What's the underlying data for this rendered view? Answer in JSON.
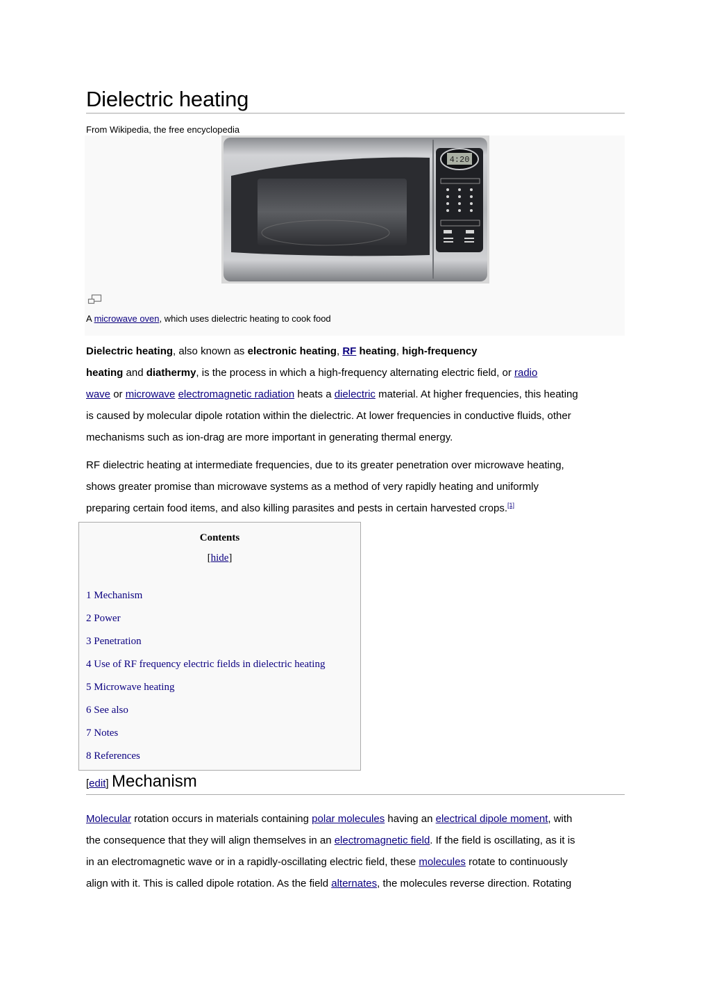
{
  "article": {
    "title": "Dielectric heating",
    "subtitle": "From Wikipedia, the free encyclopedia"
  },
  "figure": {
    "image_alt": "microwave oven photo",
    "oven_display": "4:20",
    "enlarge_icon": "magnify-clip-icon",
    "caption": {
      "prefix": "A ",
      "link": "microwave oven",
      "suffix": ", which uses dielectric heating to cook food"
    }
  },
  "intro": {
    "p1": {
      "t1": "Dielectric heating",
      "t2": ", also known as ",
      "t3": "electronic heating",
      "t4": ", ",
      "link_rf": "RF",
      "t5": " heating",
      "t6": ", ",
      "t7": "high-frequency",
      "t8": "heating",
      "t9": " and ",
      "t10": "diathermy",
      "t11": ", is the process in which a high-frequency alternating electric field, or ",
      "link_radio1": "radio",
      "link_radio2": "wave",
      "t12": " or ",
      "link_microwave": "microwave",
      "t13": " ",
      "link_emr": "electromagnetic radiation",
      "t14": " heats a ",
      "link_dielectric": "dielectric",
      "t15": " material. At higher frequencies, this heating",
      "line4": "is caused by molecular dipole rotation within the dielectric. At lower frequencies in conductive fluids, other",
      "line5": "mechanisms such as ion-drag are more important in generating thermal energy."
    },
    "p2": {
      "line1": "RF dielectric heating at intermediate frequencies, due to its greater penetration over microwave heating,",
      "line2": "shows greater promise than microwave systems as a method of very rapidly heating and uniformly",
      "line3": "preparing certain food items, and also killing parasites and pests in certain harvested crops.",
      "ref": "[1]"
    }
  },
  "toc": {
    "title": "Contents",
    "toggle_open": "[",
    "toggle_label": "hide",
    "toggle_close": "]",
    "items": [
      {
        "label": "1 Mechanism"
      },
      {
        "label": "2 Power"
      },
      {
        "label": "3 Penetration"
      },
      {
        "label": "4 Use of RF frequency electric fields in dielectric heating"
      },
      {
        "label": "5 Microwave heating"
      },
      {
        "label": "6 See also"
      },
      {
        "label": "7 Notes"
      },
      {
        "label": "8 References"
      }
    ]
  },
  "mechanism": {
    "edit_open": "[",
    "edit_label": "edit",
    "edit_close": "]",
    "heading": "Mechanism",
    "l1": {
      "link1": "Molecular",
      "t1": " rotation occurs in materials containing ",
      "link2": "polar molecules",
      "t2": " having an ",
      "link3": "electrical dipole moment",
      "t3": ", with"
    },
    "l2": {
      "t1": "the consequence that they will align themselves in an ",
      "link1": "electromagnetic field",
      "t2": ". If the field is oscillating, as it is"
    },
    "l3": {
      "t1": "in an electromagnetic wave or in a rapidly-oscillating electric field, these ",
      "link1": "molecules",
      "t2": " rotate to continuously"
    },
    "l4": {
      "t1": "align with it. This is called dipole rotation. As the field ",
      "link1": "alternates",
      "t2": ", the molecules reverse direction. Rotating"
    }
  },
  "colors": {
    "link": "#0b0080",
    "figure_bg": "#f9f9f9",
    "toc_border": "#aaaaaa"
  }
}
